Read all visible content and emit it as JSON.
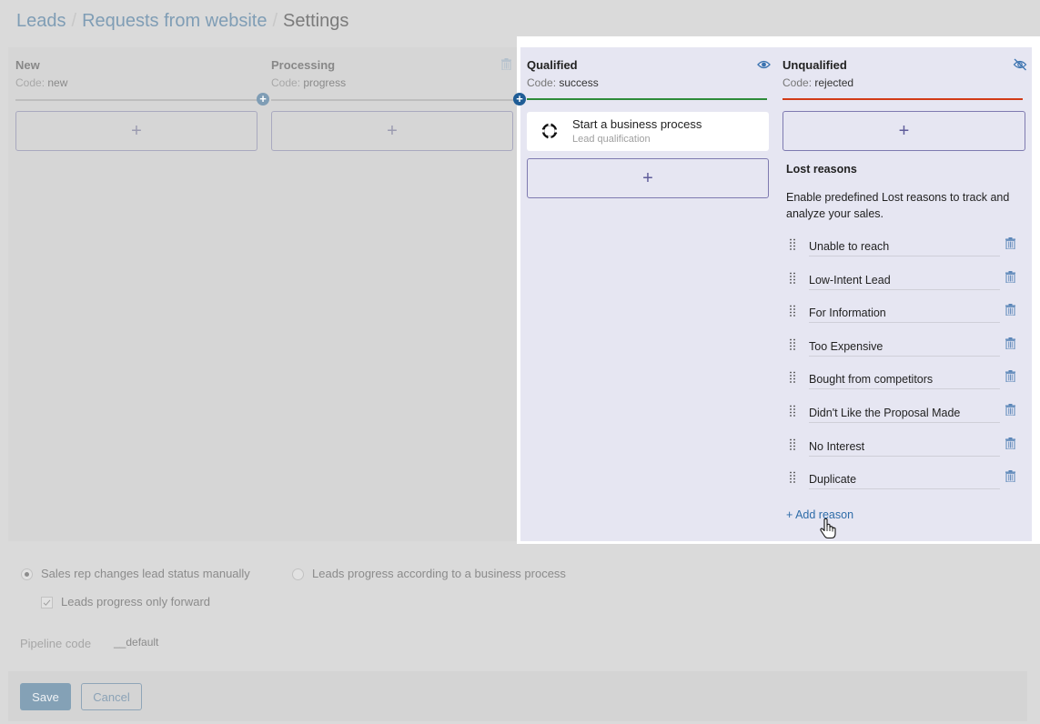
{
  "breadcrumb": {
    "items": [
      "Leads",
      "Requests from website"
    ],
    "current": "Settings",
    "separator": "/"
  },
  "stages": [
    {
      "name": "New",
      "code_label": "Code:",
      "code": "new",
      "add_label": "+"
    },
    {
      "name": "Processing",
      "code_label": "Code:",
      "code": "progress",
      "add_label": "+"
    },
    {
      "name": "Qualified",
      "code_label": "Code:",
      "code": "success",
      "add_label": "+",
      "line_color": "#2e8b3a"
    },
    {
      "name": "Unqualified",
      "code_label": "Code:",
      "code": "rejected",
      "add_label": "+",
      "line_color": "#d23b18"
    }
  ],
  "plus_dot": "+",
  "business_process": {
    "title": "Start a business process",
    "subtitle": "Lead qualification"
  },
  "lost_reasons": {
    "title": "Lost reasons",
    "description": "Enable predefined Lost reasons to track and analyze your sales.",
    "items": [
      "Unable to reach",
      "Low-Intent Lead",
      "For Information",
      "Too Expensive",
      "Bought from competitors",
      "Didn't Like the Proposal Made",
      "No Interest",
      "Duplicate"
    ],
    "add_label": "+ Add reason"
  },
  "settings": {
    "radio_manual": "Sales rep changes lead status manually",
    "radio_manual_checked": true,
    "radio_bp": "Leads progress according to a business process",
    "radio_bp_checked": false,
    "checkbox_forward": "Leads progress only forward",
    "checkbox_forward_checked": true,
    "pipeline_code_label": "Pipeline code",
    "pipeline_code_value": "__default"
  },
  "footer": {
    "save_label": "Save",
    "cancel_label": "Cancel"
  },
  "colors": {
    "accent": "#2e6ca8",
    "success_line": "#2e8b3a",
    "rejected_line": "#d23b18",
    "highlight_panel": "#e6e6f2"
  }
}
